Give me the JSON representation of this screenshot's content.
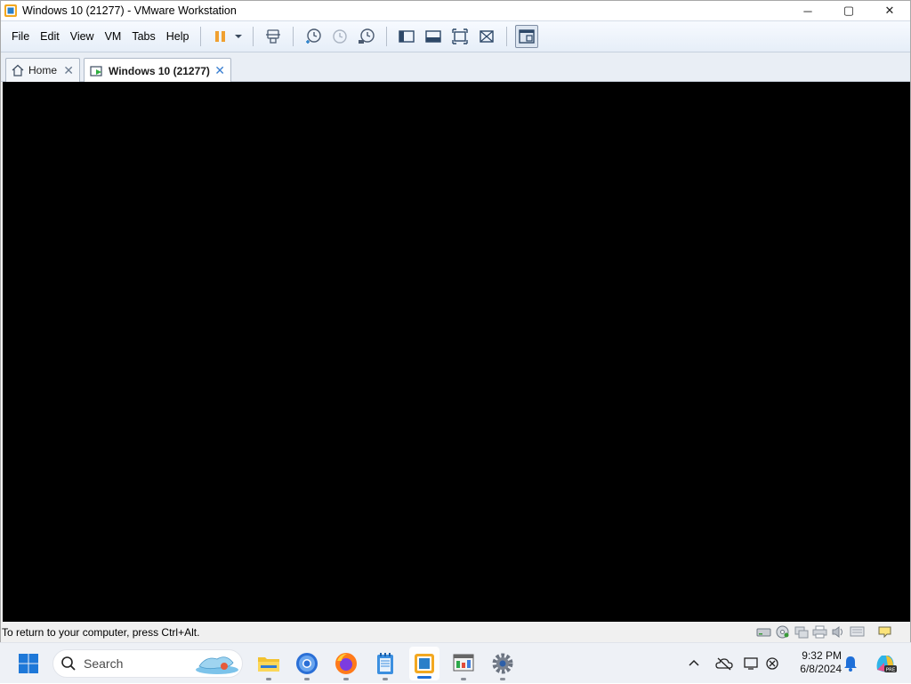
{
  "window": {
    "title": "Windows 10 (21277) - VMware Workstation",
    "controls": {
      "minimize": "─",
      "maximize": "▢",
      "close": "✕"
    }
  },
  "menu": {
    "items": [
      "File",
      "Edit",
      "View",
      "VM",
      "Tabs",
      "Help"
    ]
  },
  "toolbar": {
    "buttons": [
      "pause-icon",
      "dropdown-arrow-icon",
      "send-ctrl-alt-del-icon",
      "snapshot-take-icon",
      "snapshot-revert-icon",
      "snapshot-manager-icon",
      "library-icon",
      "thumbnail-bar-icon",
      "full-screen-icon",
      "unity-icon",
      "console-view-icon"
    ]
  },
  "tabs": [
    {
      "label": "Home",
      "icon": "home-icon"
    },
    {
      "label": "Windows 10 (21277)",
      "icon": "vm-icon",
      "active": true
    }
  ],
  "statusbar": {
    "message": "To return to your computer, press Ctrl+Alt.",
    "icons": [
      "hard-disk-icon",
      "cd-dvd-icon",
      "network-adapter-icon",
      "printer-icon",
      "sound-icon",
      "display-icon",
      "message-icon"
    ]
  },
  "taskbar": {
    "search_placeholder": "Search",
    "apps": [
      "file-explorer-icon",
      "chrome-icon",
      "firefox-icon",
      "notepad-icon",
      "vmware-icon",
      "task-manager-icon",
      "settings-icon"
    ],
    "active_app": "vmware-icon",
    "tray_icons": [
      "show-hidden-icons-icon",
      "onedrive-icon",
      "display-icon",
      "network-disconnected-icon",
      "notification-bell-icon",
      "copilot-icon"
    ],
    "time": "9:32 PM",
    "date": "6/8/2024"
  },
  "colors": {
    "accent": "#1e6fd8",
    "vm_screen": "#000000",
    "toolbar_bg": "#e6eef8",
    "pause_orange": "#f0a030"
  }
}
